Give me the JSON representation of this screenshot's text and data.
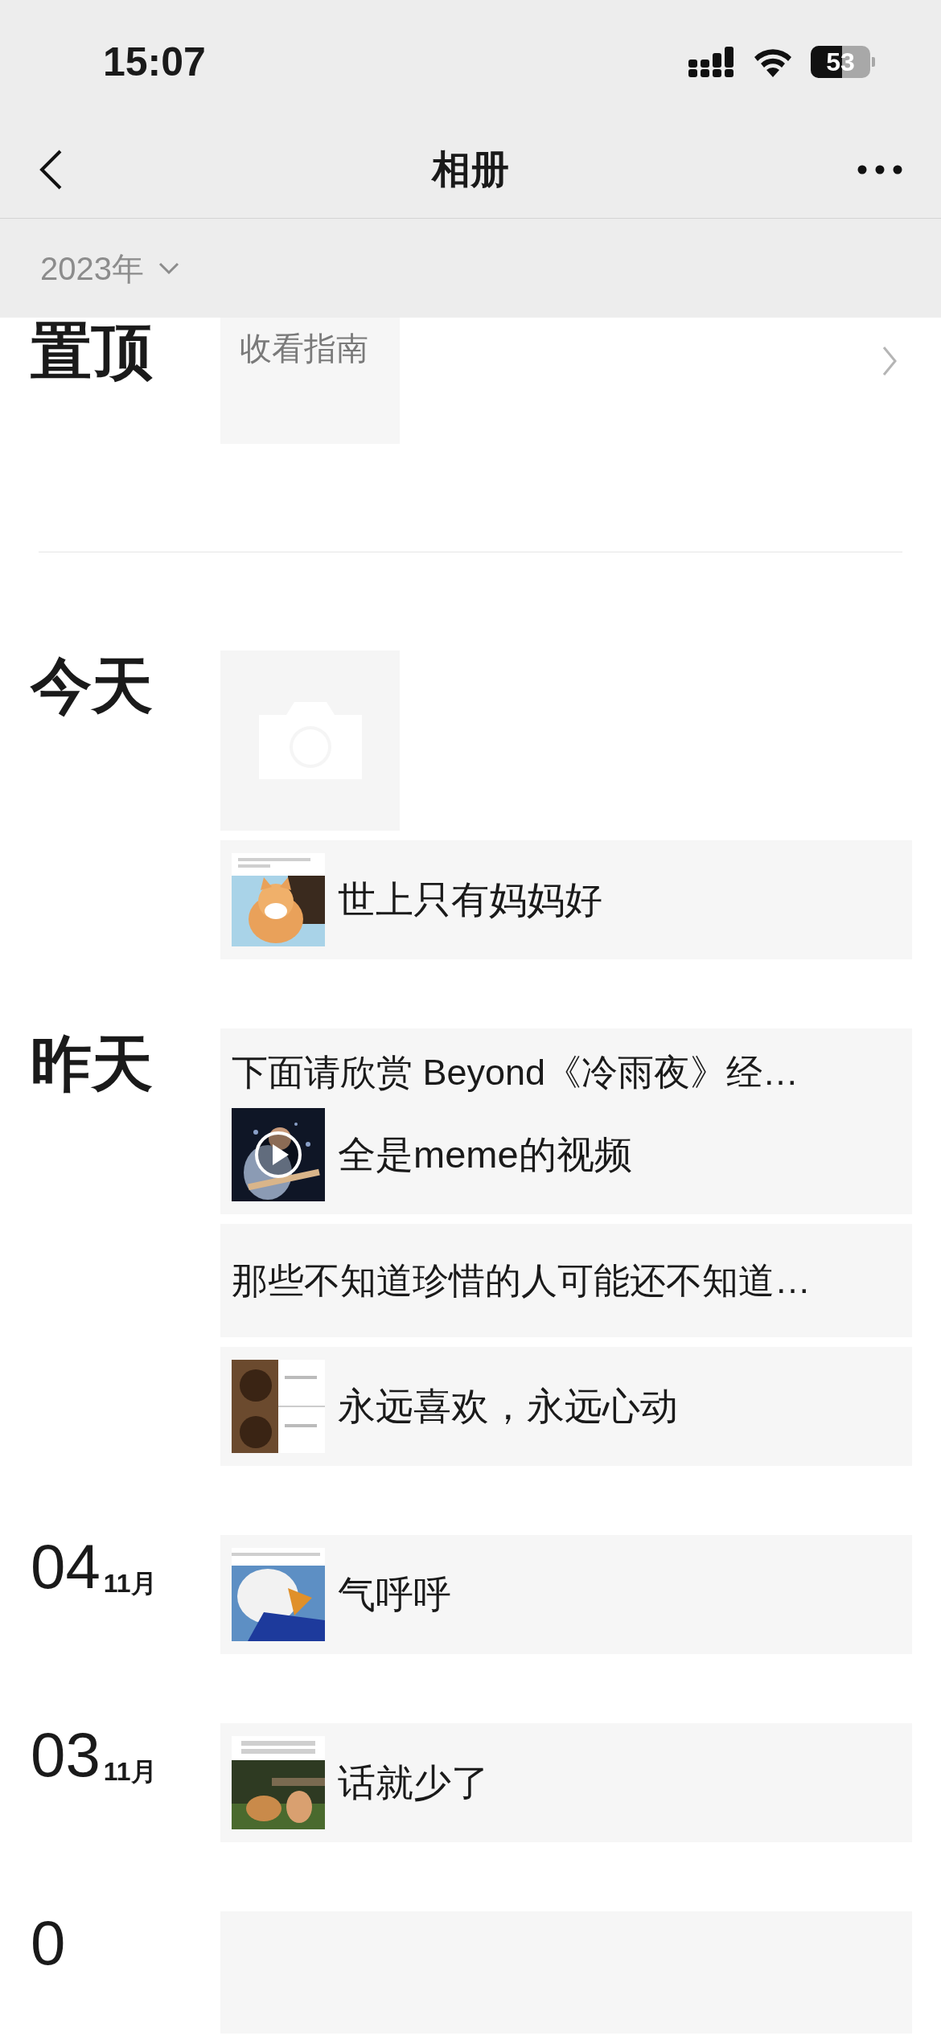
{
  "status_bar": {
    "time": "15:07",
    "battery": "53"
  },
  "nav": {
    "title": "相册"
  },
  "year_filter": {
    "label": "2023年"
  },
  "pinned": {
    "label": "置顶",
    "text": "收看指南"
  },
  "sections": [
    {
      "label": "今天",
      "items": [
        {
          "kind": "camera"
        },
        {
          "kind": "post",
          "text": "世上只有妈妈好"
        }
      ]
    },
    {
      "label": "昨天",
      "items": [
        {
          "kind": "post",
          "title": "下面请欣赏 Beyond《冷雨夜》经…",
          "media": {
            "kind": "video"
          },
          "text": "全是meme的视频"
        },
        {
          "kind": "post",
          "title": "那些不知道珍惜的人可能还不知道…"
        },
        {
          "kind": "post",
          "text": "永远喜欢，永远心动"
        }
      ]
    },
    {
      "day": "04",
      "month": "11月",
      "items": [
        {
          "kind": "post",
          "text": "气呼呼"
        }
      ]
    },
    {
      "day": "03",
      "month": "11月",
      "items": [
        {
          "kind": "post",
          "text": "话就少了"
        }
      ]
    },
    {
      "day": "0",
      "items": [
        {
          "kind": "post"
        }
      ]
    }
  ]
}
